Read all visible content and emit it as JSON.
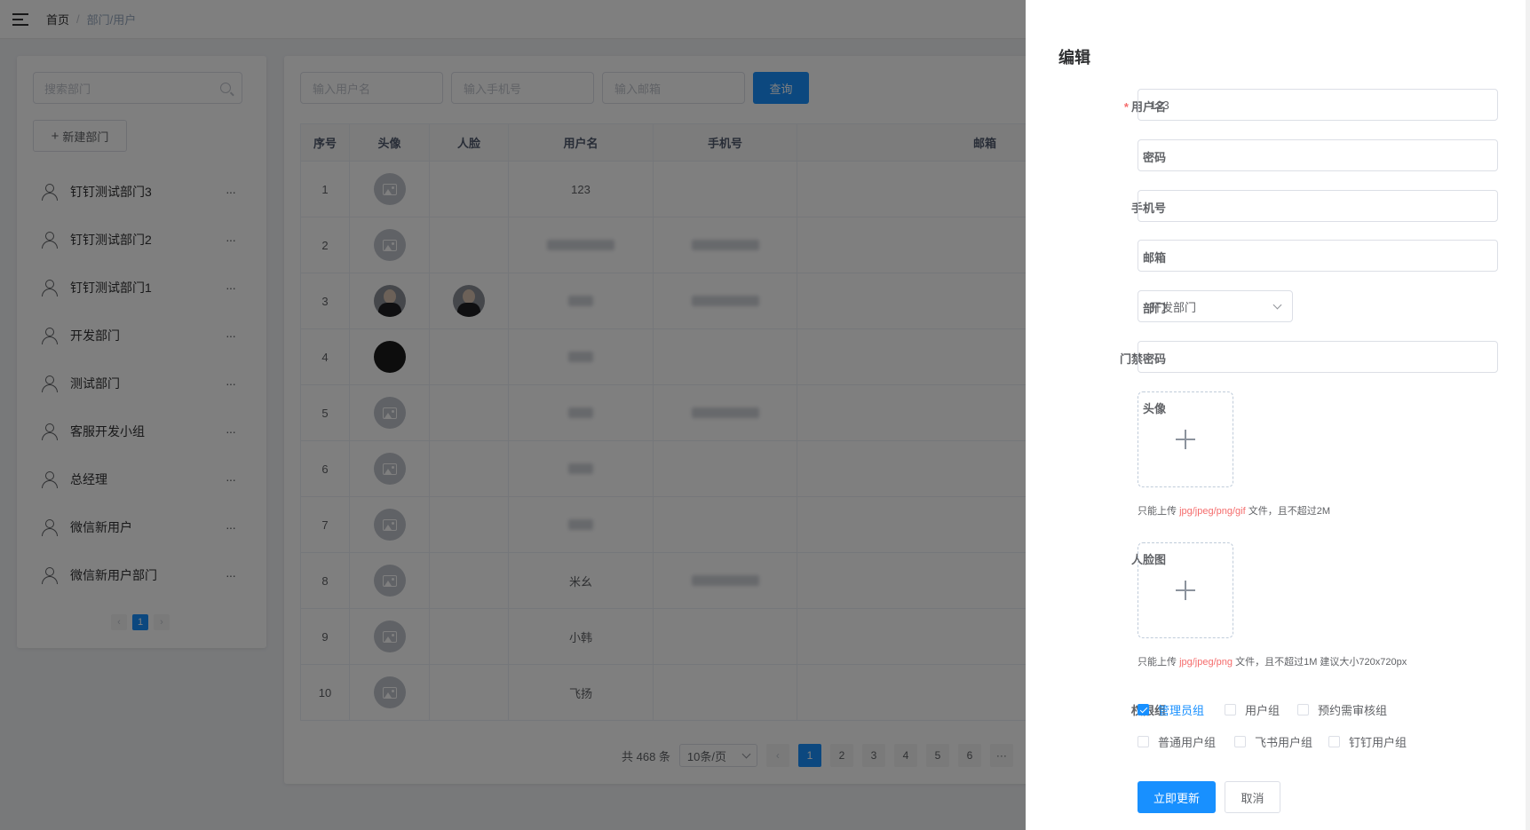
{
  "header": {
    "breadcrumb": [
      "首页",
      "部门/用户"
    ],
    "separator": "/"
  },
  "sidebar": {
    "search_placeholder": "搜索部门",
    "new_dept_label": "新建部门",
    "departments": [
      "钉钉测试部门3",
      "钉钉测试部门2",
      "钉钉测试部门1",
      "开发部门",
      "测试部门",
      "客服开发小组",
      "总经理",
      "微信新用户",
      "微信新用户部门"
    ],
    "more_label": "···",
    "pager": {
      "prev": "‹",
      "current": "1",
      "next": "›"
    }
  },
  "filters": {
    "username_placeholder": "输入用户名",
    "phone_placeholder": "输入手机号",
    "email_placeholder": "输入邮箱",
    "query_label": "查询"
  },
  "table": {
    "columns": [
      "序号",
      "头像",
      "人脸",
      "用户名",
      "手机号",
      "邮箱"
    ],
    "rows": [
      {
        "index": "1",
        "avatar": "placeholder",
        "face": false,
        "username": "123",
        "phone_blurred": false
      },
      {
        "index": "2",
        "avatar": "placeholder",
        "face": false,
        "username": "",
        "phone_blurred": true
      },
      {
        "index": "3",
        "avatar": "photo",
        "face": true,
        "username": "",
        "phone_blurred": true
      },
      {
        "index": "4",
        "avatar": "dark",
        "face": false,
        "username": "",
        "phone_blurred": false
      },
      {
        "index": "5",
        "avatar": "placeholder",
        "face": false,
        "username": "",
        "phone_blurred": true
      },
      {
        "index": "6",
        "avatar": "placeholder",
        "face": false,
        "username": "",
        "phone_blurred": false
      },
      {
        "index": "7",
        "avatar": "placeholder",
        "face": false,
        "username": "",
        "phone_blurred": false
      },
      {
        "index": "8",
        "avatar": "placeholder",
        "face": false,
        "username": "米幺",
        "phone_blurred": true
      },
      {
        "index": "9",
        "avatar": "placeholder",
        "face": false,
        "username": "小韩",
        "phone_blurred": false
      },
      {
        "index": "10",
        "avatar": "placeholder",
        "face": false,
        "username": "飞扬",
        "phone_blurred": false
      }
    ]
  },
  "pagination": {
    "total": "共 468 条",
    "page_size": "10条/页",
    "prev": "‹",
    "pages": [
      "1",
      "2",
      "3",
      "4",
      "5",
      "6"
    ],
    "more": "···",
    "current": "1"
  },
  "drawer": {
    "title": "编辑",
    "labels": {
      "username": "用户名",
      "password": "密码",
      "phone": "手机号",
      "email": "邮箱",
      "dept": "部门",
      "door_pwd": "门禁密码",
      "avatar": "头像",
      "face": "人脸图",
      "perm": "权限组"
    },
    "values": {
      "username": "123",
      "password": "",
      "phone": "",
      "email": "",
      "dept": "开发部门",
      "door_pwd": ""
    },
    "avatar_tip": {
      "pre": "只能上传",
      "types": "jpg/jpeg/png/gif",
      "post": "文件，且不超过2M"
    },
    "face_tip": {
      "pre": "只能上传",
      "types": "jpg/jpeg/png",
      "post": "文件，且不超过1M 建议大小720x720px"
    },
    "perm_groups": [
      {
        "label": "管理员组",
        "checked": true
      },
      {
        "label": "用户组",
        "checked": false
      },
      {
        "label": "预约需审核组",
        "checked": false
      },
      {
        "label": "普通用户组",
        "checked": false
      },
      {
        "label": "飞书用户组",
        "checked": false
      },
      {
        "label": "钉钉用户组",
        "checked": false
      }
    ],
    "submit_label": "立即更新",
    "cancel_label": "取消"
  },
  "colors": {
    "primary": "#1890ff",
    "danger": "#f56c6c",
    "mask": "rgba(0,0,0,0.5)"
  }
}
